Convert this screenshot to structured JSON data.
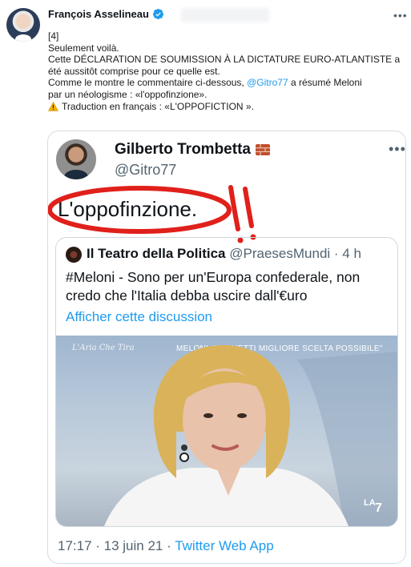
{
  "tweet": {
    "author_name": "François Asselineau",
    "lines": {
      "l1": "[4]",
      "l2": "Seulement voilà.",
      "l3": "Cette DÉCLARATION DE SOUMISSION À LA DICTATURE EURO-ATLANTISTE a",
      "l4": "été aussitôt comprise pour ce quelle est.",
      "l5_a": "Comme le montre le commentaire ci-dessous, ",
      "l5_mention": "@Gitro77",
      "l5_b": " a résumé Meloni",
      "l6": "par un néologisme : «l'oppofinzione».",
      "l7": "Traduction en français : «L'OPPOFICTION »."
    },
    "icons": {
      "verified": "verified-badge-icon",
      "more": "more-options-icon",
      "warning": "warning-icon"
    }
  },
  "embedded": {
    "author_name": "Gilberto Trombetta",
    "handle": "@Gitro77",
    "text": "L'oppofinzione.",
    "quote": {
      "author_name": "Il Teatro della Politica",
      "handle_time": "@PraesesMundi · 4 h",
      "text": "#Meloni - Sono per un'Europa confederale, non credo che l'Italia debba uscire dall'€uro",
      "link": "Afficher cette discussion",
      "video": {
        "logo": "L'Aria Che Tira",
        "banner": "MELONI: \"MICHETTI MIGLIORE SCELTA POSSIBILE\""
      }
    },
    "timestamp": "17:17 · 13 juin 21 · ",
    "app": "Twitter Web App"
  },
  "colors": {
    "accent": "#1d9bf0",
    "annotation_red": "#e0201b"
  }
}
